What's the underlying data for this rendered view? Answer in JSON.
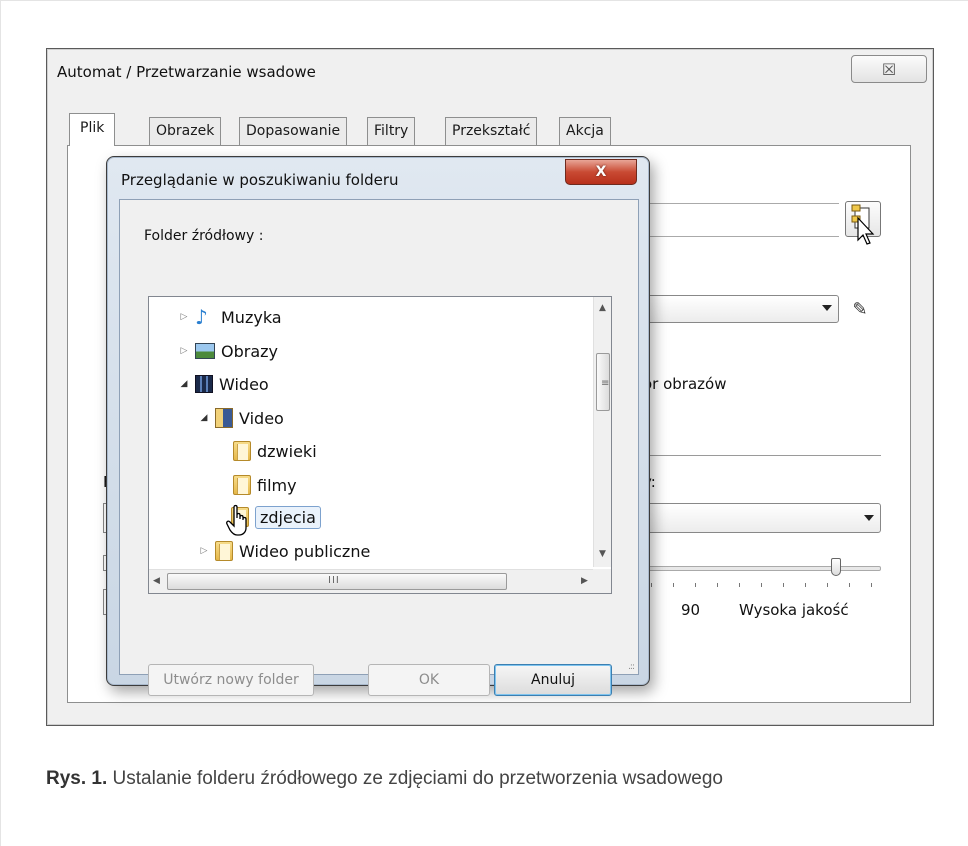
{
  "outer_window": {
    "title": "Automat / Przetwarzanie wsadowe",
    "close_glyph": "☒",
    "tabs": [
      "Plik",
      "Obrazek",
      "Dopasowanie",
      "Filtry",
      "Przekształć",
      "Akcja"
    ],
    "active_tab": "Plik",
    "partial_text_1": "ór obrazów",
    "partial_text_2": "y:",
    "quality_value": "90",
    "quality_label": "Wysoka jakość",
    "edge_letters": [
      "(",
      "F",
      "P"
    ]
  },
  "folder_dialog": {
    "title": "Przeglądanie w poszukiwaniu folderu",
    "close_glyph": "X",
    "prompt": "Folder źródłowy :",
    "tree": [
      {
        "label": "Muzyka",
        "icon": "music-icon",
        "expander": "▷"
      },
      {
        "label": "Obrazy",
        "icon": "pictures-icon",
        "expander": "▷"
      },
      {
        "label": "Wideo",
        "icon": "video-icon",
        "expander": "◢"
      },
      {
        "label": "Video",
        "icon": "video-library-icon",
        "expander": "◢"
      },
      {
        "label": "dzwieki",
        "icon": "folder-icon",
        "expander": ""
      },
      {
        "label": "filmy",
        "icon": "folder-icon",
        "expander": ""
      },
      {
        "label": "zdjecia",
        "icon": "folder-icon",
        "expander": "",
        "selected": true
      },
      {
        "label": "Wideo publiczne",
        "icon": "folder-icon",
        "expander": "▷"
      }
    ],
    "scroll_grip_v": "≡",
    "scroll_grip_h": "III",
    "buttons": {
      "new_folder": "Utwórz nowy folder",
      "ok": "OK",
      "cancel": "Anuluj"
    }
  },
  "caption": {
    "prefix": "Rys. 1.",
    "text": " Ustalanie folderu źródłowego ze zdjęciami do przetworzenia wsadowego"
  }
}
